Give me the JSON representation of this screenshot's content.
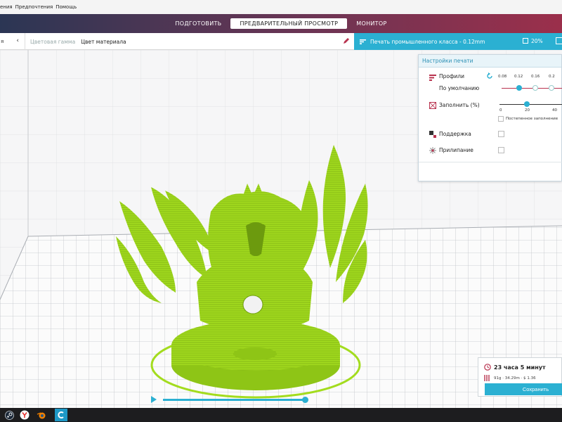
{
  "menubar": {
    "items": [
      "ения",
      "Предпочтения",
      "Помощь"
    ]
  },
  "stages": [
    {
      "label": "ПОДГОТОВИТЬ",
      "active": false
    },
    {
      "label": "ПРЕДВАРИТЕЛЬНЫЙ ПРОСМОТР",
      "active": true
    },
    {
      "label": "МОНИТОР",
      "active": false
    }
  ],
  "material_panel": {
    "label": "я"
  },
  "color_scheme": {
    "label": "Цветовая гамма",
    "value": "Цвет материала"
  },
  "print_setup": {
    "profile_text": "Печать промышленного класса - 0.12mm",
    "infill_percent": "20%"
  },
  "print_settings": {
    "title": "Настройки печати",
    "profiles_label": "Профили",
    "profile_default": "По умолчанию",
    "layer_heights": [
      "0.08",
      "0.12",
      "0.16",
      "0.2"
    ],
    "selected_layer_height": "0.12",
    "infill_label": "Заполнить (%)",
    "infill_ticks": [
      "0",
      "20",
      "40"
    ],
    "infill_value": 20,
    "gradual_infill_label": "Постепенное заполнение",
    "support_label": "Поддержка",
    "adhesion_label": "Прилипание"
  },
  "estimate": {
    "time": "23 часа 5 минут",
    "details": "91g · 34.29m · $ 1.36",
    "save_label": "Сохранить"
  },
  "layer_slider": {
    "position": 1.0
  },
  "colors": {
    "accent": "#2bb0d2",
    "model": "#a3dc1e",
    "header_left": "#2b3654",
    "header_right": "#9b2f4b",
    "profile_icon": "#b8324e"
  },
  "taskbar": {
    "icons": [
      "steam-icon",
      "yandex-browser-icon",
      "blender-icon",
      "cura-icon"
    ]
  }
}
